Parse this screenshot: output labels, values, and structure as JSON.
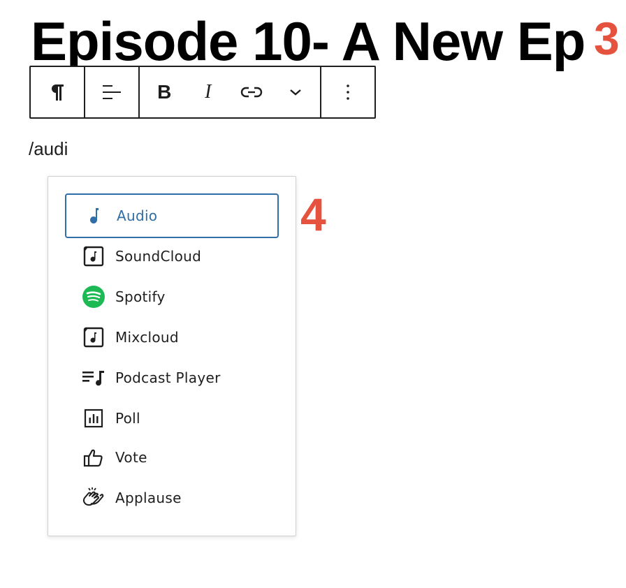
{
  "post": {
    "title": "Episode 10- A New Ep"
  },
  "annotations": {
    "step3": "3",
    "step4": "4"
  },
  "paragraph": {
    "text": "/audi"
  },
  "toolbar": {
    "buttons": [
      "paragraph-icon",
      "align-left-icon",
      "bold-icon",
      "italic-icon",
      "link-icon",
      "chevron-down-icon",
      "more-vertical-icon"
    ],
    "bold_label": "B",
    "italic_label": "I"
  },
  "inserter": {
    "items": [
      {
        "label": "Audio",
        "icon": "audio-note-icon",
        "selected": true
      },
      {
        "label": "SoundCloud",
        "icon": "soundcloud-icon"
      },
      {
        "label": "Spotify",
        "icon": "spotify-icon"
      },
      {
        "label": "Mixcloud",
        "icon": "mixcloud-icon"
      },
      {
        "label": "Podcast Player",
        "icon": "podcast-player-icon"
      },
      {
        "label": "Poll",
        "icon": "poll-icon"
      },
      {
        "label": "Vote",
        "icon": "thumbs-up-icon"
      },
      {
        "label": "Applause",
        "icon": "applause-icon"
      }
    ]
  },
  "colors": {
    "accent": "#2f6ea7",
    "annotation": "#e5533f",
    "spotify": "#1db954"
  }
}
